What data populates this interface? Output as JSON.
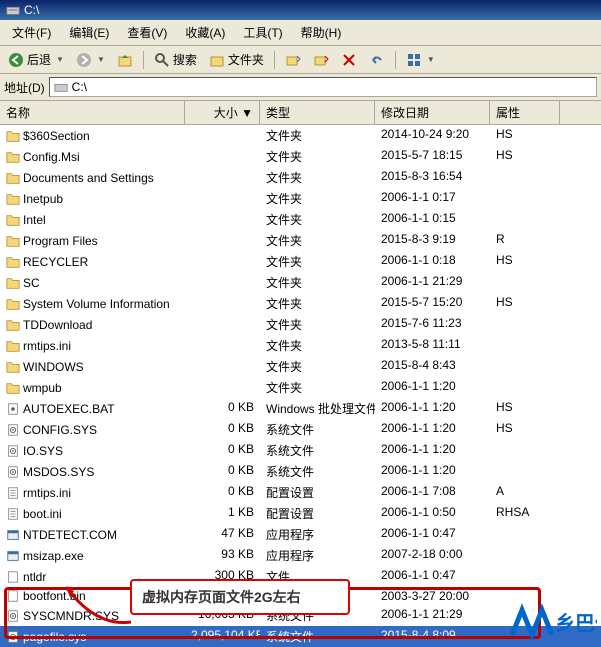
{
  "title": "C:\\",
  "menu": [
    "文件(F)",
    "编辑(E)",
    "查看(V)",
    "收藏(A)",
    "工具(T)",
    "帮助(H)"
  ],
  "toolbar": {
    "back": "后退",
    "search": "搜索",
    "folders": "文件夹"
  },
  "addressbar": {
    "label": "地址(D)",
    "path": "C:\\"
  },
  "columns": {
    "name": "名称",
    "size": "大小",
    "type": "类型",
    "date": "修改日期",
    "attr": "属性"
  },
  "rows": [
    {
      "icon": "folder",
      "name": "$360Section",
      "size": "",
      "type": "文件夹",
      "date": "2014-10-24 9:20",
      "attr": "HS"
    },
    {
      "icon": "folder",
      "name": "Config.Msi",
      "size": "",
      "type": "文件夹",
      "date": "2015-5-7 18:15",
      "attr": "HS"
    },
    {
      "icon": "folder",
      "name": "Documents and Settings",
      "size": "",
      "type": "文件夹",
      "date": "2015-8-3 16:54",
      "attr": ""
    },
    {
      "icon": "folder",
      "name": "Inetpub",
      "size": "",
      "type": "文件夹",
      "date": "2006-1-1 0:17",
      "attr": ""
    },
    {
      "icon": "folder",
      "name": "Intel",
      "size": "",
      "type": "文件夹",
      "date": "2006-1-1 0:15",
      "attr": ""
    },
    {
      "icon": "folder",
      "name": "Program Files",
      "size": "",
      "type": "文件夹",
      "date": "2015-8-3 9:19",
      "attr": "R"
    },
    {
      "icon": "folder",
      "name": "RECYCLER",
      "size": "",
      "type": "文件夹",
      "date": "2006-1-1 0:18",
      "attr": "HS"
    },
    {
      "icon": "folder",
      "name": "SC",
      "size": "",
      "type": "文件夹",
      "date": "2006-1-1 21:29",
      "attr": ""
    },
    {
      "icon": "folder",
      "name": "System Volume Information",
      "size": "",
      "type": "文件夹",
      "date": "2015-5-7 15:20",
      "attr": "HS"
    },
    {
      "icon": "folder",
      "name": "TDDownload",
      "size": "",
      "type": "文件夹",
      "date": "2015-7-6 11:23",
      "attr": ""
    },
    {
      "icon": "folder",
      "name": "rmtips.ini",
      "size": "",
      "type": "文件夹",
      "date": "2013-5-8 11:11",
      "attr": ""
    },
    {
      "icon": "folder",
      "name": "WINDOWS",
      "size": "",
      "type": "文件夹",
      "date": "2015-8-4 8:43",
      "attr": ""
    },
    {
      "icon": "folder",
      "name": "wmpub",
      "size": "",
      "type": "文件夹",
      "date": "2006-1-1 1:20",
      "attr": ""
    },
    {
      "icon": "bat",
      "name": "AUTOEXEC.BAT",
      "size": "0 KB",
      "type": "Windows 批处理文件",
      "date": "2006-1-1 1:20",
      "attr": "HS"
    },
    {
      "icon": "sys",
      "name": "CONFIG.SYS",
      "size": "0 KB",
      "type": "系统文件",
      "date": "2006-1-1 1:20",
      "attr": "HS"
    },
    {
      "icon": "sys",
      "name": "IO.SYS",
      "size": "0 KB",
      "type": "系统文件",
      "date": "2006-1-1 1:20",
      "attr": ""
    },
    {
      "icon": "sys",
      "name": "MSDOS.SYS",
      "size": "0 KB",
      "type": "系统文件",
      "date": "2006-1-1 1:20",
      "attr": ""
    },
    {
      "icon": "ini",
      "name": "rmtips.ini",
      "size": "0 KB",
      "type": "配置设置",
      "date": "2006-1-1 7:08",
      "attr": "A"
    },
    {
      "icon": "ini",
      "name": "boot.ini",
      "size": "1 KB",
      "type": "配置设置",
      "date": "2006-1-1 0:50",
      "attr": "RHSA"
    },
    {
      "icon": "exe",
      "name": "NTDETECT.COM",
      "size": "47 KB",
      "type": "应用程序",
      "date": "2006-1-1 0:47",
      "attr": ""
    },
    {
      "icon": "exe",
      "name": "msizap.exe",
      "size": "93 KB",
      "type": "应用程序",
      "date": "2007-2-18 0:00",
      "attr": ""
    },
    {
      "icon": "file",
      "name": "ntldr",
      "size": "300 KB",
      "type": "文件",
      "date": "2006-1-1 0:47",
      "attr": ""
    },
    {
      "icon": "file",
      "name": "bootfont.bin",
      "size": "",
      "type": "",
      "date": "2003-3-27 20:00",
      "attr": ""
    },
    {
      "icon": "sys",
      "name": "SYSCMNDR.SYS",
      "size": "16,065 KB",
      "type": "系统文件",
      "date": "2006-1-1 21:29",
      "attr": ""
    },
    {
      "icon": "sys",
      "name": "pagefile.sys",
      "size": "2,095,104 KB",
      "type": "系统文件",
      "date": "2015-8-4 8:09",
      "attr": "",
      "sel": true
    }
  ],
  "callout": "虚拟内存页面文件2G左右",
  "watermark": "乡巴佬"
}
